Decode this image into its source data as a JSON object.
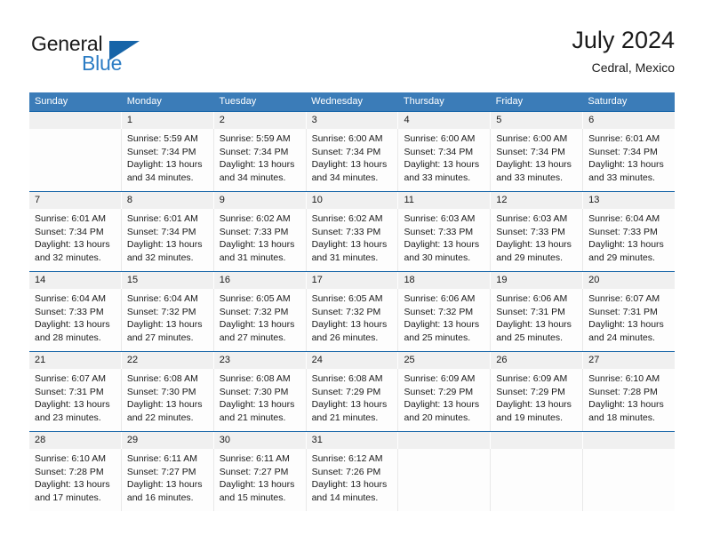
{
  "brand": {
    "name_part1": "General",
    "name_part2": "Blue",
    "logo_icon": "triangle-flag-icon"
  },
  "header": {
    "title": "July 2024",
    "subtitle": "Cedral, Mexico"
  },
  "colors": {
    "header_blue": "#3b7cb8",
    "rule_blue": "#1664a8",
    "brand_blue": "#2b7cc4",
    "number_band": "#f0f0f0",
    "cell_background": "#fdfdfd"
  },
  "weekdays": [
    "Sunday",
    "Monday",
    "Tuesday",
    "Wednesday",
    "Thursday",
    "Friday",
    "Saturday"
  ],
  "weeks": [
    {
      "numbers": [
        "",
        "1",
        "2",
        "3",
        "4",
        "5",
        "6"
      ],
      "cells": [
        {
          "lines": []
        },
        {
          "lines": [
            "Sunrise: 5:59 AM",
            "Sunset: 7:34 PM",
            "Daylight: 13 hours",
            "and 34 minutes."
          ]
        },
        {
          "lines": [
            "Sunrise: 5:59 AM",
            "Sunset: 7:34 PM",
            "Daylight: 13 hours",
            "and 34 minutes."
          ]
        },
        {
          "lines": [
            "Sunrise: 6:00 AM",
            "Sunset: 7:34 PM",
            "Daylight: 13 hours",
            "and 34 minutes."
          ]
        },
        {
          "lines": [
            "Sunrise: 6:00 AM",
            "Sunset: 7:34 PM",
            "Daylight: 13 hours",
            "and 33 minutes."
          ]
        },
        {
          "lines": [
            "Sunrise: 6:00 AM",
            "Sunset: 7:34 PM",
            "Daylight: 13 hours",
            "and 33 minutes."
          ]
        },
        {
          "lines": [
            "Sunrise: 6:01 AM",
            "Sunset: 7:34 PM",
            "Daylight: 13 hours",
            "and 33 minutes."
          ]
        }
      ]
    },
    {
      "numbers": [
        "7",
        "8",
        "9",
        "10",
        "11",
        "12",
        "13"
      ],
      "cells": [
        {
          "lines": [
            "Sunrise: 6:01 AM",
            "Sunset: 7:34 PM",
            "Daylight: 13 hours",
            "and 32 minutes."
          ]
        },
        {
          "lines": [
            "Sunrise: 6:01 AM",
            "Sunset: 7:34 PM",
            "Daylight: 13 hours",
            "and 32 minutes."
          ]
        },
        {
          "lines": [
            "Sunrise: 6:02 AM",
            "Sunset: 7:33 PM",
            "Daylight: 13 hours",
            "and 31 minutes."
          ]
        },
        {
          "lines": [
            "Sunrise: 6:02 AM",
            "Sunset: 7:33 PM",
            "Daylight: 13 hours",
            "and 31 minutes."
          ]
        },
        {
          "lines": [
            "Sunrise: 6:03 AM",
            "Sunset: 7:33 PM",
            "Daylight: 13 hours",
            "and 30 minutes."
          ]
        },
        {
          "lines": [
            "Sunrise: 6:03 AM",
            "Sunset: 7:33 PM",
            "Daylight: 13 hours",
            "and 29 minutes."
          ]
        },
        {
          "lines": [
            "Sunrise: 6:04 AM",
            "Sunset: 7:33 PM",
            "Daylight: 13 hours",
            "and 29 minutes."
          ]
        }
      ]
    },
    {
      "numbers": [
        "14",
        "15",
        "16",
        "17",
        "18",
        "19",
        "20"
      ],
      "cells": [
        {
          "lines": [
            "Sunrise: 6:04 AM",
            "Sunset: 7:33 PM",
            "Daylight: 13 hours",
            "and 28 minutes."
          ]
        },
        {
          "lines": [
            "Sunrise: 6:04 AM",
            "Sunset: 7:32 PM",
            "Daylight: 13 hours",
            "and 27 minutes."
          ]
        },
        {
          "lines": [
            "Sunrise: 6:05 AM",
            "Sunset: 7:32 PM",
            "Daylight: 13 hours",
            "and 27 minutes."
          ]
        },
        {
          "lines": [
            "Sunrise: 6:05 AM",
            "Sunset: 7:32 PM",
            "Daylight: 13 hours",
            "and 26 minutes."
          ]
        },
        {
          "lines": [
            "Sunrise: 6:06 AM",
            "Sunset: 7:32 PM",
            "Daylight: 13 hours",
            "and 25 minutes."
          ]
        },
        {
          "lines": [
            "Sunrise: 6:06 AM",
            "Sunset: 7:31 PM",
            "Daylight: 13 hours",
            "and 25 minutes."
          ]
        },
        {
          "lines": [
            "Sunrise: 6:07 AM",
            "Sunset: 7:31 PM",
            "Daylight: 13 hours",
            "and 24 minutes."
          ]
        }
      ]
    },
    {
      "numbers": [
        "21",
        "22",
        "23",
        "24",
        "25",
        "26",
        "27"
      ],
      "cells": [
        {
          "lines": [
            "Sunrise: 6:07 AM",
            "Sunset: 7:31 PM",
            "Daylight: 13 hours",
            "and 23 minutes."
          ]
        },
        {
          "lines": [
            "Sunrise: 6:08 AM",
            "Sunset: 7:30 PM",
            "Daylight: 13 hours",
            "and 22 minutes."
          ]
        },
        {
          "lines": [
            "Sunrise: 6:08 AM",
            "Sunset: 7:30 PM",
            "Daylight: 13 hours",
            "and 21 minutes."
          ]
        },
        {
          "lines": [
            "Sunrise: 6:08 AM",
            "Sunset: 7:29 PM",
            "Daylight: 13 hours",
            "and 21 minutes."
          ]
        },
        {
          "lines": [
            "Sunrise: 6:09 AM",
            "Sunset: 7:29 PM",
            "Daylight: 13 hours",
            "and 20 minutes."
          ]
        },
        {
          "lines": [
            "Sunrise: 6:09 AM",
            "Sunset: 7:29 PM",
            "Daylight: 13 hours",
            "and 19 minutes."
          ]
        },
        {
          "lines": [
            "Sunrise: 6:10 AM",
            "Sunset: 7:28 PM",
            "Daylight: 13 hours",
            "and 18 minutes."
          ]
        }
      ]
    },
    {
      "numbers": [
        "28",
        "29",
        "30",
        "31",
        "",
        "",
        ""
      ],
      "cells": [
        {
          "lines": [
            "Sunrise: 6:10 AM",
            "Sunset: 7:28 PM",
            "Daylight: 13 hours",
            "and 17 minutes."
          ]
        },
        {
          "lines": [
            "Sunrise: 6:11 AM",
            "Sunset: 7:27 PM",
            "Daylight: 13 hours",
            "and 16 minutes."
          ]
        },
        {
          "lines": [
            "Sunrise: 6:11 AM",
            "Sunset: 7:27 PM",
            "Daylight: 13 hours",
            "and 15 minutes."
          ]
        },
        {
          "lines": [
            "Sunrise: 6:12 AM",
            "Sunset: 7:26 PM",
            "Daylight: 13 hours",
            "and 14 minutes."
          ]
        },
        {
          "lines": []
        },
        {
          "lines": []
        },
        {
          "lines": []
        }
      ]
    }
  ]
}
